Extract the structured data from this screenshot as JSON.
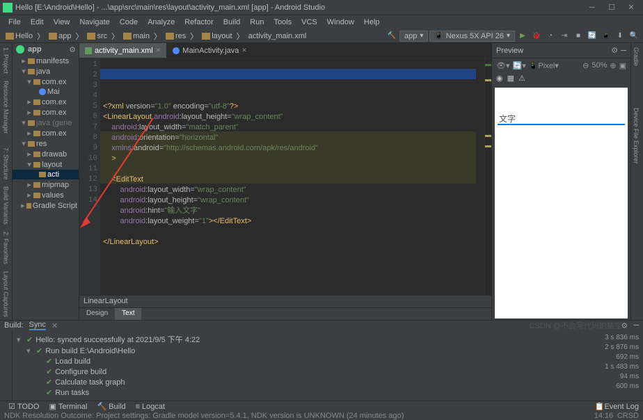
{
  "window": {
    "title": "Hello [E:\\Android\\Hello] - ...\\app\\src\\main\\res\\layout\\activity_main.xml [app] - Android Studio"
  },
  "menu": [
    "File",
    "Edit",
    "View",
    "Navigate",
    "Code",
    "Analyze",
    "Refactor",
    "Build",
    "Run",
    "Tools",
    "VCS",
    "Window",
    "Help"
  ],
  "breadcrumb": [
    "Hello",
    "app",
    "src",
    "main",
    "res",
    "layout",
    "activity_main.xml"
  ],
  "run_config": {
    "app": "app",
    "device": "Nexus 5X API 26"
  },
  "sidebar": {
    "tabs": [
      "1: Project",
      "7: Structure"
    ],
    "tabs2": [
      "Resource Manager",
      "Build Variants"
    ],
    "tree": {
      "root": "app",
      "items": [
        {
          "l": 1,
          "ico": "folder",
          "t": "manifests",
          "exp": "▸"
        },
        {
          "l": 1,
          "ico": "folder",
          "t": "java",
          "exp": "▾"
        },
        {
          "l": 2,
          "ico": "folder",
          "t": "com.ex",
          "exp": "▾"
        },
        {
          "l": 3,
          "ico": "java",
          "t": "Mai",
          "sel": false
        },
        {
          "l": 2,
          "ico": "folder",
          "t": "com.ex",
          "exp": "▸"
        },
        {
          "l": 2,
          "ico": "folder",
          "t": "com.ex",
          "exp": "▸"
        },
        {
          "l": 1,
          "ico": "folder",
          "t": "java (gene",
          "exp": "▾",
          "dim": true
        },
        {
          "l": 2,
          "ico": "folder",
          "t": "com.ex",
          "exp": "▸"
        },
        {
          "l": 1,
          "ico": "folder",
          "t": "res",
          "exp": "▾"
        },
        {
          "l": 2,
          "ico": "folder",
          "t": "drawab",
          "exp": "▸"
        },
        {
          "l": 2,
          "ico": "folder",
          "t": "layout",
          "exp": "▾"
        },
        {
          "l": 3,
          "ico": "xml",
          "t": "acti",
          "sel": true
        },
        {
          "l": 2,
          "ico": "folder",
          "t": "mipmap",
          "exp": "▸"
        },
        {
          "l": 2,
          "ico": "folder",
          "t": "values",
          "exp": "▸"
        },
        {
          "l": 1,
          "ico": "gradle",
          "t": "Gradle Script",
          "exp": "▸"
        }
      ]
    }
  },
  "editor": {
    "tabs": [
      {
        "label": "activity_main.xml",
        "active": true,
        "ico": "xml"
      },
      {
        "label": "MainActivity.java",
        "active": false,
        "ico": "java"
      }
    ],
    "code_lines": [
      {
        "n": 1,
        "html": "<span class='hl-tag'>&lt;?xml</span> <span class='hl-attr'>version</span>=<span class='hl-val'>\"1.0\"</span> <span class='hl-attr'>encoding</span>=<span class='hl-val'>\"utf-8\"</span><span class='hl-tag'>?&gt;</span>"
      },
      {
        "n": 2,
        "html": "<span class='hl-tag'>&lt;LinearLayout</span> <span class='hl-ns'>android</span><span class='hl-attr'>:layout_height</span>=<span class='hl-val'>\"wrap_content\"</span>"
      },
      {
        "n": 3,
        "html": "    <span class='hl-ns'>android</span><span class='hl-attr'>:layout_width</span>=<span class='hl-val'>\"match_parent\"</span>"
      },
      {
        "n": 4,
        "html": "    <span class='hl-ns'>android</span><span class='hl-attr'>:orientation</span>=<span class='hl-val'>\"horizontal\"</span>"
      },
      {
        "n": 5,
        "html": "    <span class='hl-ns'>xmlns:</span><span class='hl-attr'>android</span>=<span class='hl-val'>\"http://schemas.android.com/apk/res/android\"</span>"
      },
      {
        "n": 6,
        "html": "    <span class='hl-tag'>&gt;</span>"
      },
      {
        "n": 7,
        "html": ""
      },
      {
        "n": 8,
        "html": "    <span class='hl-tag'>&lt;EditText</span>"
      },
      {
        "n": 9,
        "html": "        <span class='hl-ns'>android</span><span class='hl-attr'>:layout_width</span>=<span class='hl-val'>\"wrap_content\"</span>"
      },
      {
        "n": 10,
        "html": "        <span class='hl-ns'>android</span><span class='hl-attr'>:layout_height</span>=<span class='hl-val'>\"wrap_content\"</span>"
      },
      {
        "n": 11,
        "html": "        <span class='hl-ns'>android</span><span class='hl-attr'>:hint</span>=<span class='hl-val'>\"输入文字\"</span>"
      },
      {
        "n": 12,
        "html": "        <span class='hl-ns'>android</span><span class='hl-attr'>:layout_weight</span>=<span class='hl-val'>\"1\"</span><span class='hl-tag'>&gt;&lt;/EditText&gt;</span>"
      },
      {
        "n": 13,
        "html": ""
      },
      {
        "n": 14,
        "html": "<span class='hl-tag'>&lt;/LinearLayout&gt;</span>"
      }
    ],
    "breadcrumb": "LinearLayout",
    "design_tabs": [
      "Design",
      "Text"
    ]
  },
  "preview": {
    "title": "Preview",
    "zoom": "50%",
    "device": "Pixel",
    "phone_hint": "文字"
  },
  "build": {
    "header": {
      "build": "Build:",
      "sync": "Sync"
    },
    "rows": [
      {
        "l": 0,
        "t": "Hello: synced successfully at 2021/9/5 下午 4:22",
        "chk": true
      },
      {
        "l": 1,
        "t": "Run build E:\\Android\\Hello",
        "chk": true
      },
      {
        "l": 2,
        "t": "Load build",
        "chk": true
      },
      {
        "l": 2,
        "t": "Configure build",
        "chk": true
      },
      {
        "l": 2,
        "t": "Calculate task graph",
        "chk": true
      },
      {
        "l": 2,
        "t": "Run tasks",
        "chk": true
      }
    ],
    "times": [
      "3 s 836 ms",
      "2 s 876 ms",
      "692 ms",
      "1 s 483 ms",
      "94 ms",
      "600 ms"
    ]
  },
  "status": {
    "tabs": [
      "TODO",
      "Terminal",
      "Build",
      "Logcat"
    ],
    "msg": "NDK Resolution Outcome: Project settings: Gradle model version=5.4.1, NDK version is UNKNOWN (24 minutes ago)",
    "event": "Event Log",
    "time": "14:16",
    "branding": "CRSD"
  },
  "watermark": "CSDN @不会写代码的猿宝"
}
